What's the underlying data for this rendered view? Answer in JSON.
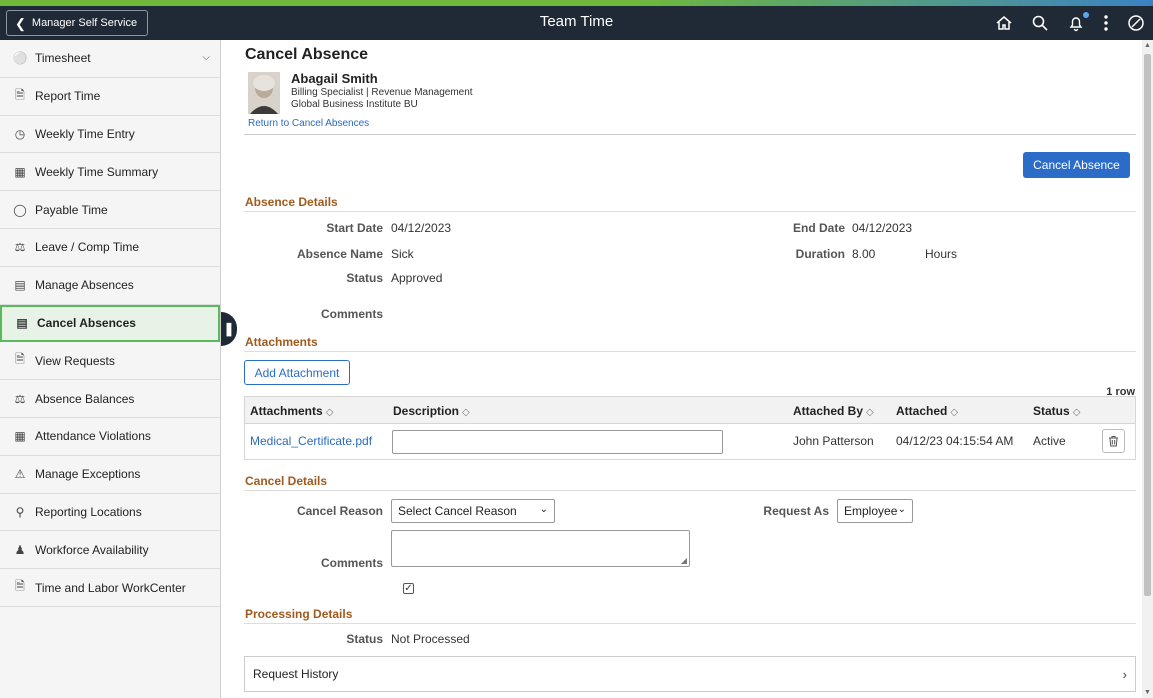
{
  "topbar": {
    "back_label": "Manager Self Service",
    "title": "Team Time",
    "icons": [
      "home-icon",
      "search-icon",
      "bell-icon",
      "more-icon",
      "compass-icon"
    ]
  },
  "sidebar": {
    "items": [
      {
        "label": "Timesheet",
        "icon": "person-clock-icon",
        "expandable": true
      },
      {
        "label": "Report Time",
        "icon": "report-icon"
      },
      {
        "label": "Weekly Time Entry",
        "icon": "clock-icon"
      },
      {
        "label": "Weekly Time Summary",
        "icon": "calendar-grid-icon"
      },
      {
        "label": "Payable Time",
        "icon": "payable-icon"
      },
      {
        "label": "Leave / Comp Time",
        "icon": "scale-icon"
      },
      {
        "label": "Manage Absences",
        "icon": "building-icon"
      },
      {
        "label": "Cancel Absences",
        "icon": "building-cancel-icon",
        "active": true
      },
      {
        "label": "View Requests",
        "icon": "document-icon"
      },
      {
        "label": "Absence Balances",
        "icon": "scale-icon"
      },
      {
        "label": "Attendance Violations",
        "icon": "calendar-icon"
      },
      {
        "label": "Manage Exceptions",
        "icon": "warning-icon"
      },
      {
        "label": "Reporting Locations",
        "icon": "location-icon"
      },
      {
        "label": "Workforce Availability",
        "icon": "people-icon"
      },
      {
        "label": "Time and Labor WorkCenter",
        "icon": "workcenter-icon"
      }
    ]
  },
  "page": {
    "title": "Cancel Absence",
    "cancel_button": "Cancel Absence",
    "return_link": "Return to Cancel Absences"
  },
  "employee": {
    "name": "Abagail Smith",
    "title_line": "Billing Specialist | Revenue Management",
    "org_line": "Global Business Institute BU"
  },
  "absence_details": {
    "heading": "Absence Details",
    "start_date_label": "Start Date",
    "start_date": "04/12/2023",
    "end_date_label": "End Date",
    "end_date": "04/12/2023",
    "absence_name_label": "Absence Name",
    "absence_name": "Sick",
    "duration_label": "Duration",
    "duration": "8.00",
    "duration_unit": "Hours",
    "status_label": "Status",
    "status": "Approved",
    "comments_label": "Comments"
  },
  "attachments": {
    "heading": "Attachments",
    "add_button": "Add Attachment",
    "row_count": "1 row",
    "columns": [
      "Attachments",
      "Description",
      "Attached By",
      "Attached",
      "Status"
    ],
    "rows": [
      {
        "file": "Medical_Certificate.pdf",
        "description": "",
        "attached_by": "John Patterson",
        "attached": "04/12/23 04:15:54 AM",
        "status": "Active"
      }
    ]
  },
  "cancel_details": {
    "heading": "Cancel Details",
    "reason_label": "Cancel Reason",
    "reason_value": "Select Cancel Reason",
    "request_as_label": "Request As",
    "request_as_value": "Employee",
    "comments_label": "Comments"
  },
  "processing_details": {
    "heading": "Processing Details",
    "status_label": "Status",
    "status": "Not Processed",
    "history_label": "Request History"
  }
}
